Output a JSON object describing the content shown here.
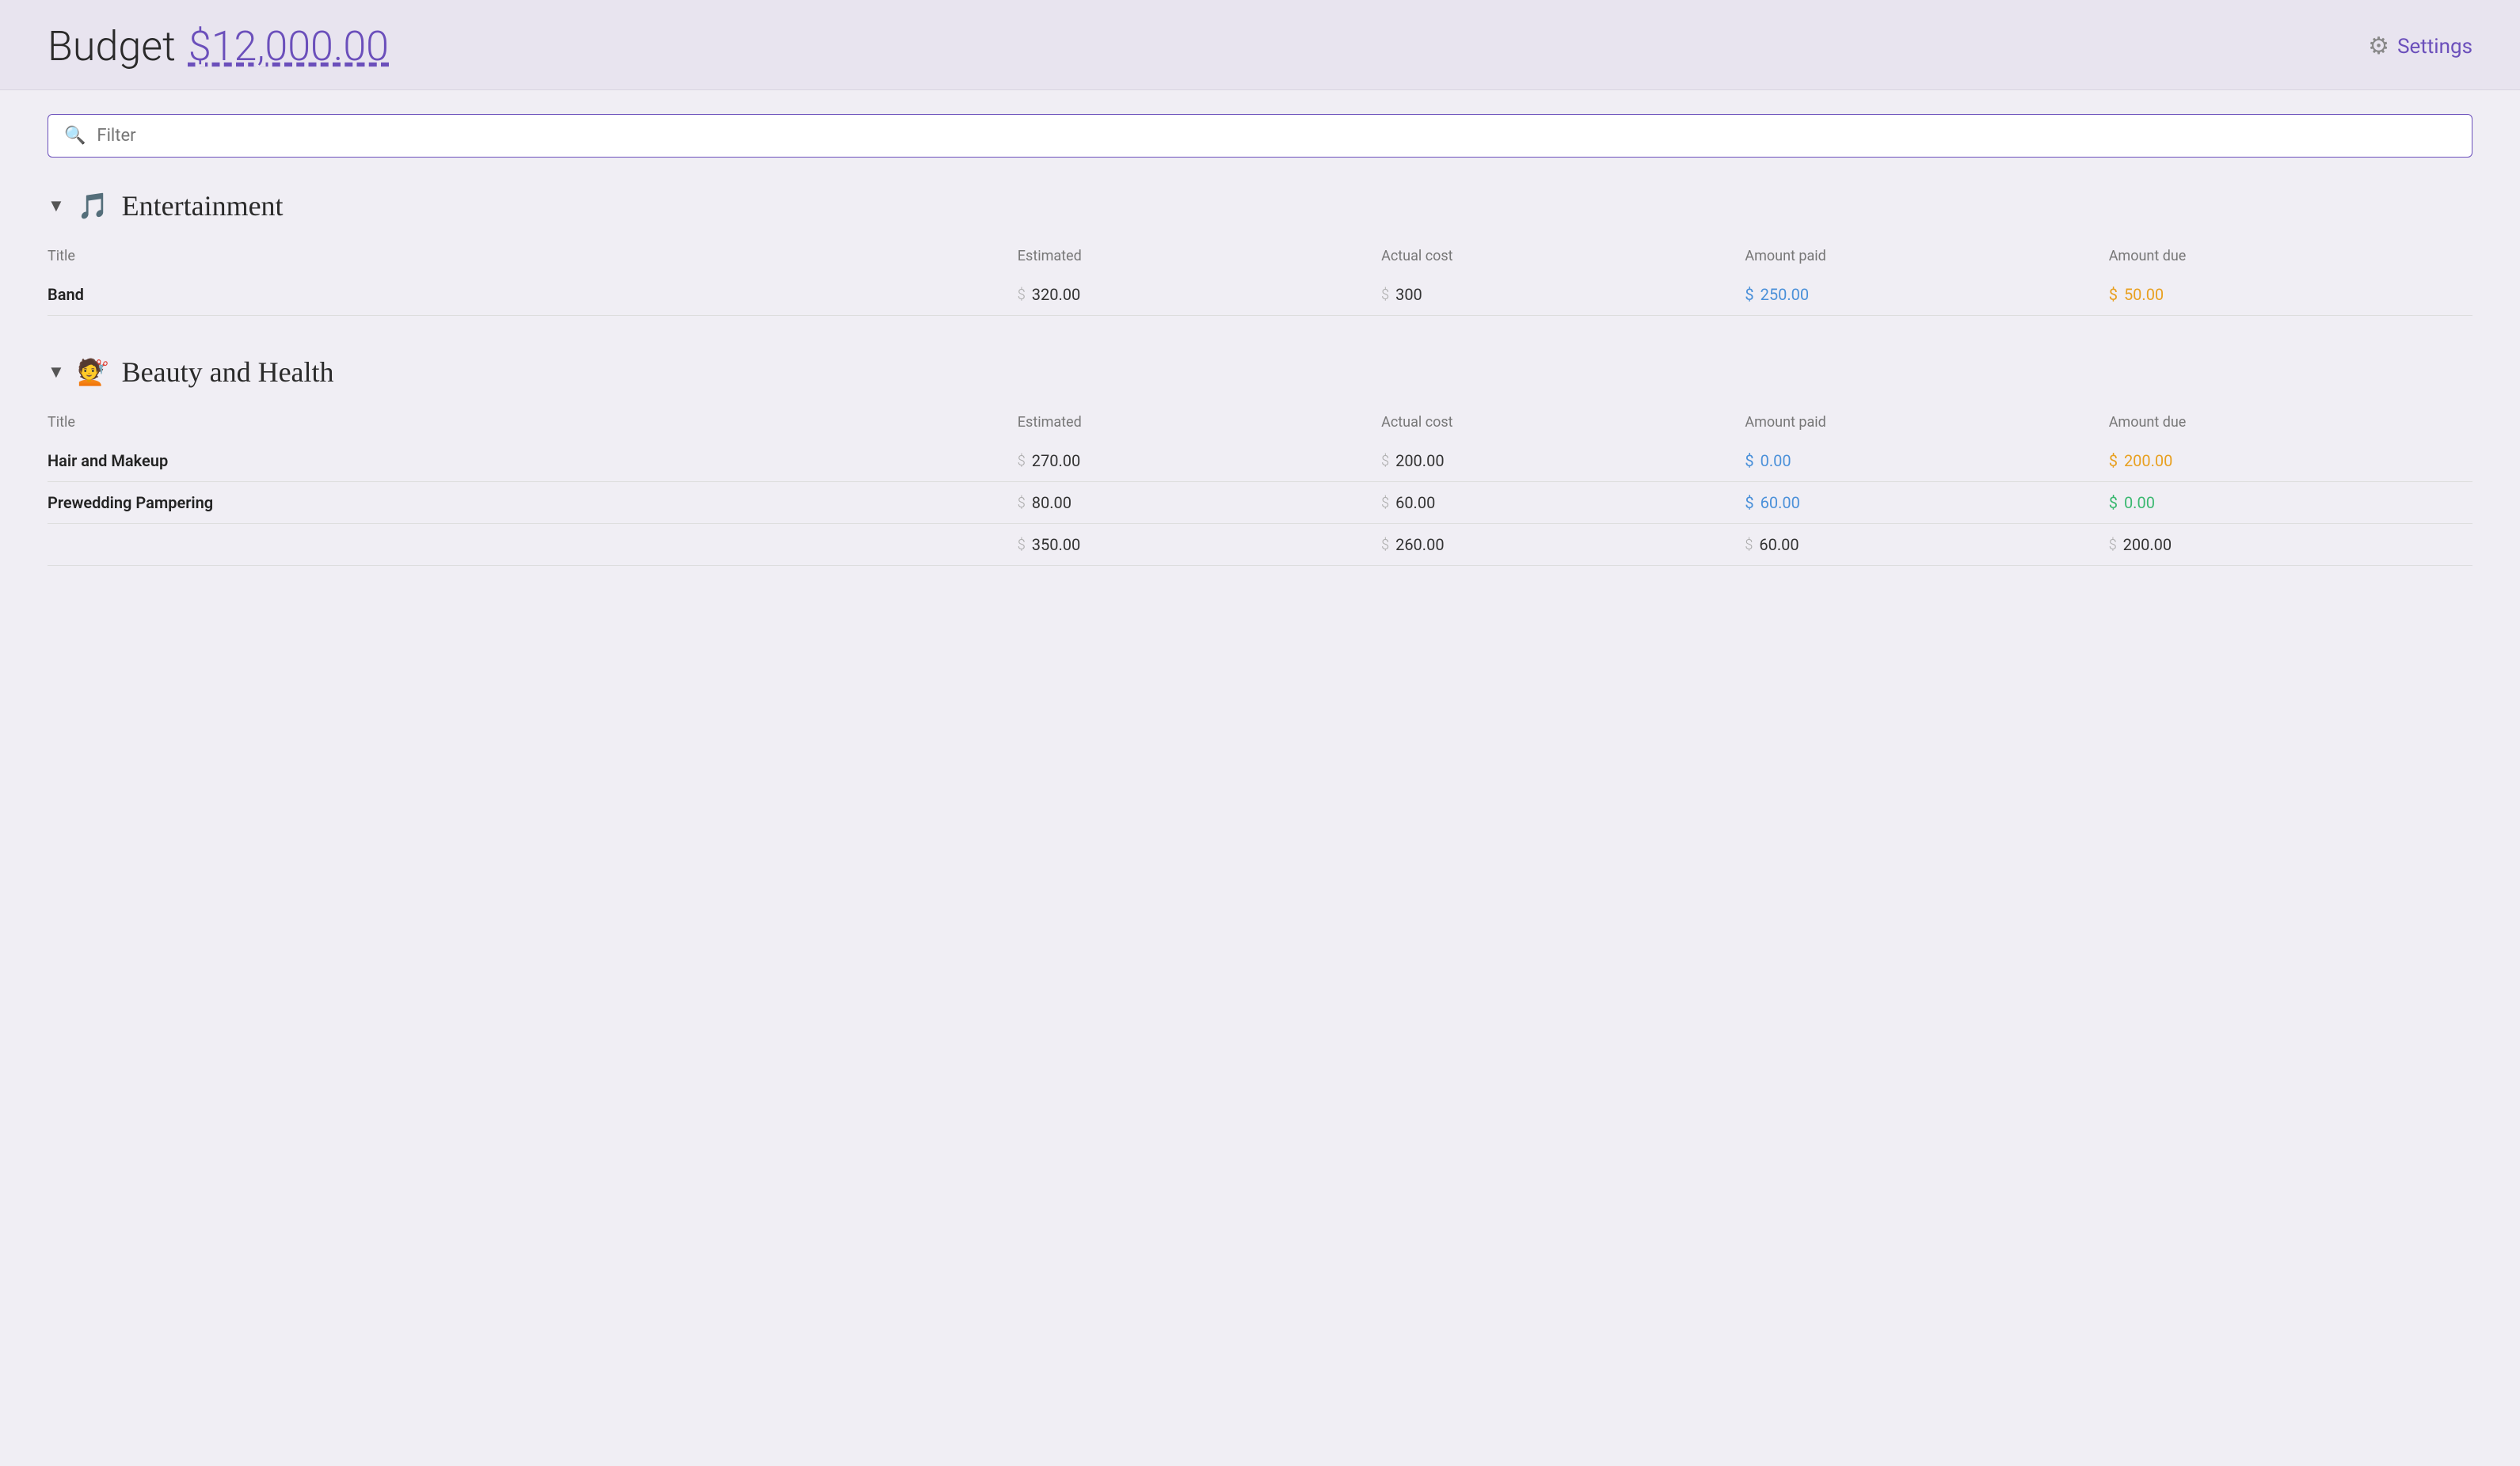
{
  "header": {
    "title": "Budget",
    "amount": "$12,000.00",
    "settings_label": "Settings"
  },
  "filter": {
    "placeholder": "Filter"
  },
  "sections": [
    {
      "id": "entertainment",
      "icon": "♩♫♪",
      "title": "Entertainment",
      "columns": [
        "Title",
        "Estimated",
        "Actual cost",
        "Amount paid",
        "Amount due"
      ],
      "rows": [
        {
          "title": "Band",
          "estimated": "320.00",
          "actual_cost": "300",
          "amount_paid": "250.00",
          "amount_due": "50.00",
          "paid_color": "blue",
          "due_color": "orange"
        }
      ],
      "totals": null
    },
    {
      "id": "beauty-health",
      "icon": "💇",
      "title": "Beauty and Health",
      "columns": [
        "Title",
        "Estimated",
        "Actual cost",
        "Amount paid",
        "Amount due"
      ],
      "rows": [
        {
          "title": "Hair and Makeup",
          "estimated": "270.00",
          "actual_cost": "200.00",
          "amount_paid": "0.00",
          "amount_due": "200.00",
          "paid_color": "blue",
          "due_color": "orange"
        },
        {
          "title": "Prewedding Pampering",
          "estimated": "80.00",
          "actual_cost": "60.00",
          "amount_paid": "60.00",
          "amount_due": "0.00",
          "paid_color": "blue",
          "due_color": "green"
        }
      ],
      "totals": {
        "estimated": "350.00",
        "actual_cost": "260.00",
        "amount_paid": "60.00",
        "amount_due": "200.00"
      }
    }
  ]
}
